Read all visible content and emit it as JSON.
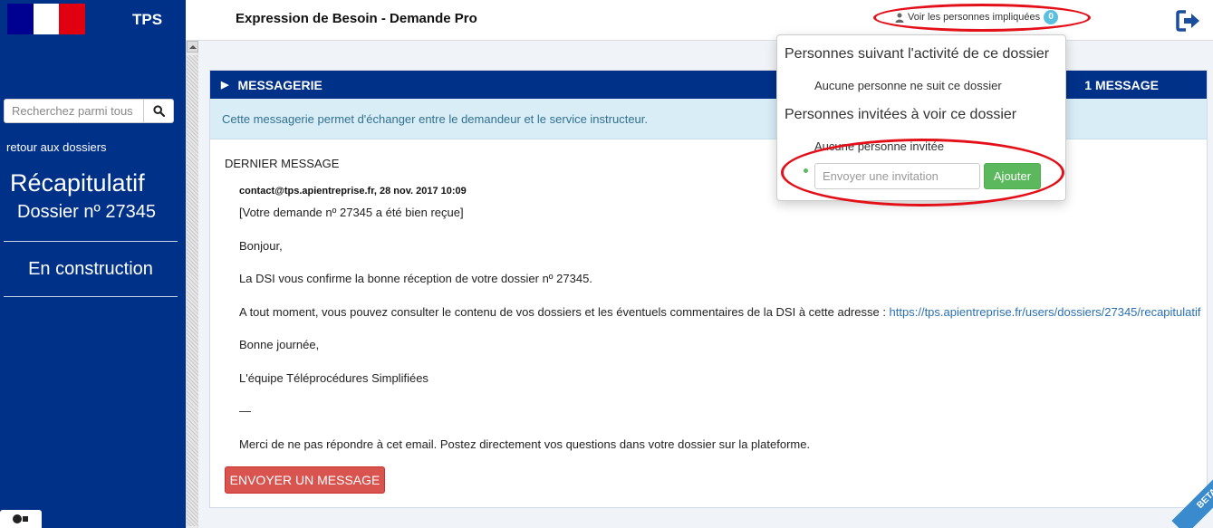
{
  "sidebar": {
    "app_name": "TPS",
    "search_placeholder": "Recherchez parmi tous",
    "back_link": "retour aux dossiers",
    "recap_title": "Récapitulatif",
    "dossier_number": "Dossier nº 27345",
    "status": "En construction"
  },
  "header": {
    "title": "Expression de Besoin - Demande Pro",
    "people_link": "Voir les personnes impliquées",
    "people_count": "0"
  },
  "popover": {
    "followers_title": "Personnes suivant l'activité de ce dossier",
    "followers_empty": "Aucune personne ne suit ce dossier",
    "invited_title": "Personnes invitées à voir ce dossier",
    "invited_empty": "Aucune personne invitée",
    "invite_placeholder": "Envoyer une invitation",
    "add_button": "Ajouter"
  },
  "messagerie": {
    "title": "MESSAGERIE",
    "count": "1 MESSAGE",
    "info": "Cette messagerie permet d'échanger entre le demandeur et le service instructeur.",
    "last_message_label": "DERNIER MESSAGE",
    "meta": "contact@tps.apientreprise.fr, 28 nov. 2017 10:09",
    "lines": [
      "[Votre demande nº 27345 a été bien reçue]",
      "Bonjour,",
      "La DSI vous confirme la bonne réception de votre dossier nº 27345.",
      "A tout moment, vous pouvez consulter le contenu de vos dossiers et les éventuels commentaires de la DSI à cette adresse : ",
      "Bonne journée,",
      "L'équipe Téléprocédures Simplifiées",
      "—",
      "Merci de ne pas répondre à cet email. Postez directement vos questions dans votre dossier sur la plateforme."
    ],
    "link": "https://tps.apientreprise.fr/users/dossiers/27345/recapitulatif",
    "send_button": "ENVOYER UN MESSAGE"
  },
  "beta_label": "BETA",
  "colors": {
    "primary": "#003189",
    "info_bg": "#d9edf7",
    "danger": "#d9534f",
    "success": "#5cb85c",
    "annotation": "#e3101a"
  }
}
